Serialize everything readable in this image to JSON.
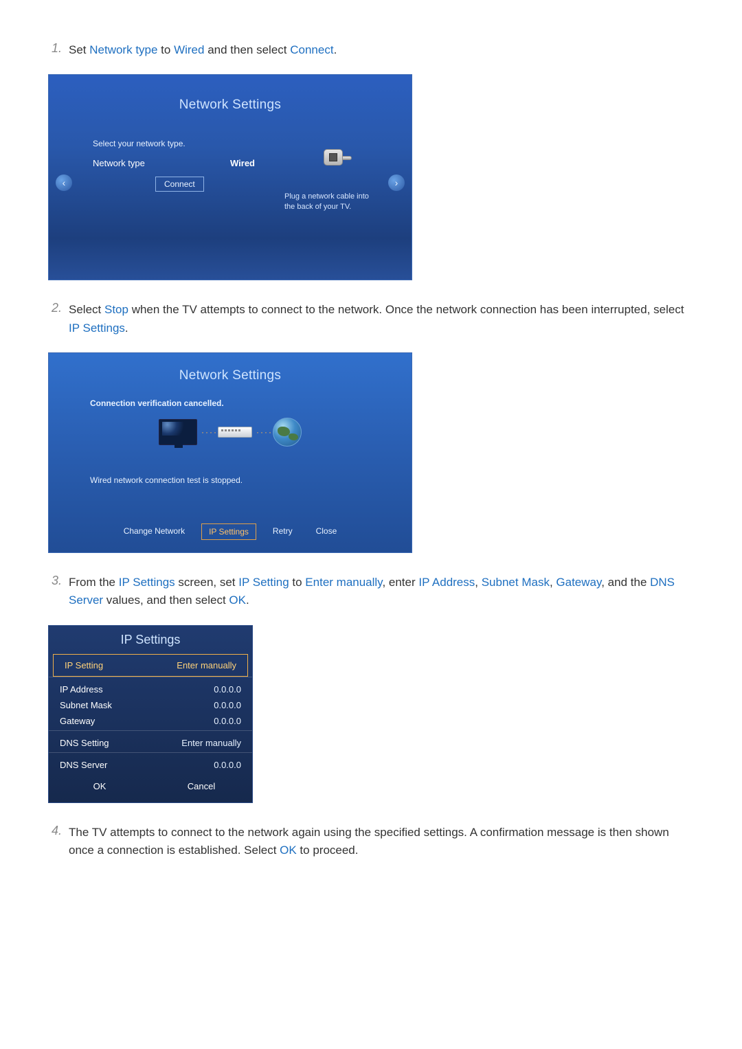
{
  "steps": {
    "1": {
      "num": "1.",
      "pre": "Set ",
      "a": "Network type",
      "mid": " to ",
      "b": "Wired",
      "mid2": " and then select ",
      "c": "Connect",
      "post": "."
    },
    "2": {
      "num": "2.",
      "pre": "Select ",
      "a": "Stop",
      "mid": " when the TV attempts to connect to the network. Once the network connection has been interrupted, select ",
      "b": "IP Settings",
      "post": "."
    },
    "3": {
      "num": "3.",
      "pre": "From the ",
      "a": "IP Settings",
      "mid": " screen, set ",
      "b": "IP Setting",
      "mid2": " to ",
      "c": "Enter manually",
      "mid3": ", enter ",
      "d": "IP Address",
      "mid4": ", ",
      "e": "Subnet Mask",
      "mid5": ", ",
      "f": "Gateway",
      "mid6": ", and the ",
      "g": "DNS Server",
      "mid7": " values, and then select ",
      "h": "OK",
      "post": "."
    },
    "4": {
      "num": "4.",
      "text": "The TV attempts to connect to the network again using the specified settings. A confirmation message is then shown once a connection is established. Select ",
      "a": "OK",
      "post": " to proceed."
    }
  },
  "panel1": {
    "title": "Network Settings",
    "sub": "Select your network type.",
    "row_label": "Network type",
    "row_value": "Wired",
    "connect": "Connect",
    "tip": "Plug a network cable into the back of your TV.",
    "left": "‹",
    "right": "›"
  },
  "panel2": {
    "title": "Network Settings",
    "line1": "Connection verification cancelled.",
    "line2": "Wired network connection test is stopped.",
    "dots": "····",
    "btn_change": "Change Network",
    "btn_ip": "IP Settings",
    "btn_retry": "Retry",
    "btn_close": "Close"
  },
  "panel3": {
    "title": "IP Settings",
    "rows": {
      "ip_setting": {
        "l": "IP Setting",
        "v": "Enter manually"
      },
      "ip_addr": {
        "l": "IP Address",
        "v": "0.0.0.0"
      },
      "subnet": {
        "l": "Subnet Mask",
        "v": "0.0.0.0"
      },
      "gateway": {
        "l": "Gateway",
        "v": "0.0.0.0"
      },
      "dns_setting": {
        "l": "DNS Setting",
        "v": "Enter manually"
      },
      "dns_server": {
        "l": "DNS Server",
        "v": "0.0.0.0"
      }
    },
    "ok": "OK",
    "cancel": "Cancel"
  }
}
